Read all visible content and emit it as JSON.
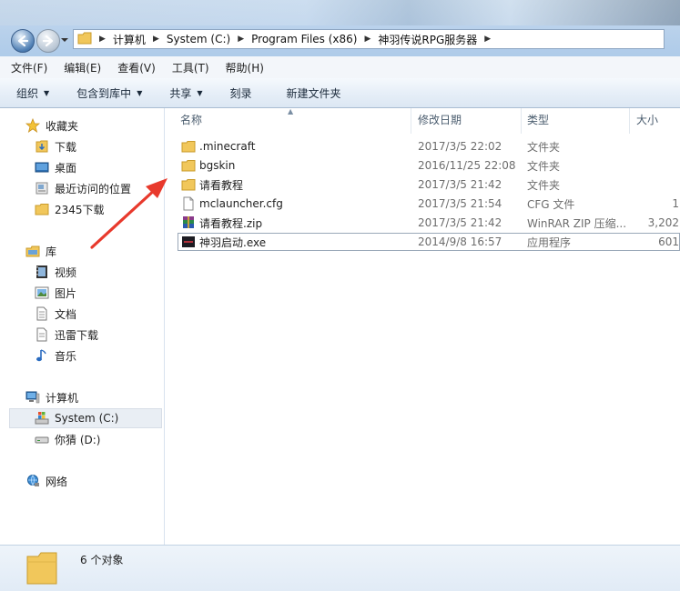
{
  "address": {
    "crumbs": [
      "计算机",
      "System (C:)",
      "Program Files (x86)",
      "神羽传说RPG服务器"
    ]
  },
  "menu": [
    "文件(F)",
    "编辑(E)",
    "查看(V)",
    "工具(T)",
    "帮助(H)"
  ],
  "toolbar": {
    "organize": "组织",
    "include_in_library": "包含到库中",
    "share": "共享",
    "burn": "刻录",
    "new_folder": "新建文件夹"
  },
  "sidebar": {
    "favorites": {
      "header": "收藏夹",
      "items": [
        "下载",
        "桌面",
        "最近访问的位置",
        "2345下载"
      ]
    },
    "libraries": {
      "header": "库",
      "items": [
        "视频",
        "图片",
        "文档",
        "迅雷下载",
        "音乐"
      ]
    },
    "computer": {
      "header": "计算机",
      "items": [
        "System (C:)",
        "你猜 (D:)"
      ]
    },
    "network": {
      "header": "网络"
    }
  },
  "columns": {
    "name": "名称",
    "modified": "修改日期",
    "type": "类型",
    "size": "大小"
  },
  "files": [
    {
      "name": ".minecraft",
      "modified": "2017/3/5 22:02",
      "type": "文件夹",
      "size": "",
      "icon": "folder-icon"
    },
    {
      "name": "bgskin",
      "modified": "2016/11/25 22:08",
      "type": "文件夹",
      "size": "",
      "icon": "folder-icon"
    },
    {
      "name": "请看教程",
      "modified": "2017/3/5 21:42",
      "type": "文件夹",
      "size": "",
      "icon": "folder-icon"
    },
    {
      "name": "mclauncher.cfg",
      "modified": "2017/3/5 21:54",
      "type": "CFG 文件",
      "size": "1",
      "icon": "file-icon"
    },
    {
      "name": "请看教程.zip",
      "modified": "2017/3/5 21:42",
      "type": "WinRAR ZIP 压缩...",
      "size": "3,202",
      "icon": "winrar-icon"
    },
    {
      "name": "神羽启动.exe",
      "modified": "2014/9/8 16:57",
      "type": "应用程序",
      "size": "601",
      "icon": "exe-icon"
    }
  ],
  "status": {
    "count_text": "6 个对象"
  },
  "colors": {
    "annotation_arrow": "#e8392c",
    "folder": "#f1c75b"
  }
}
